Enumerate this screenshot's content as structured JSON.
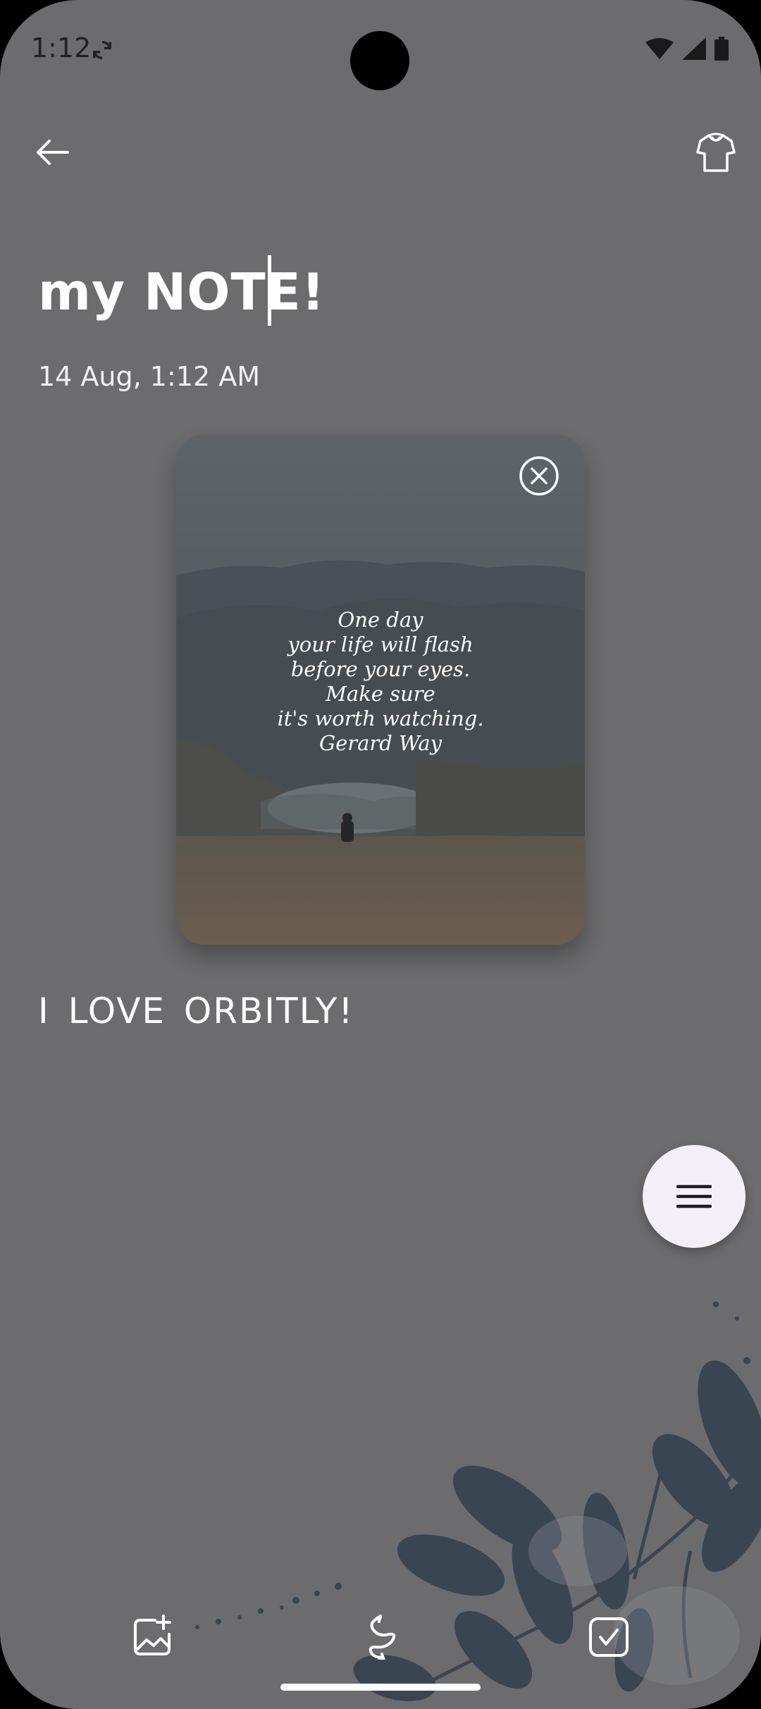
{
  "status_bar": {
    "time": "1:12",
    "icons": [
      "sync-icon",
      "wifi-icon",
      "signal-icon",
      "battery-icon"
    ]
  },
  "toolbar": {
    "back_icon": "arrow-left-icon",
    "theme_icon": "shirt-icon"
  },
  "note": {
    "title": "my NOTE!",
    "date": "14 Aug, 1:12  AM",
    "body": "I  LOVE  ORBITLY!"
  },
  "attached_image": {
    "quote_lines": [
      "One day",
      "your life will flash",
      "before your eyes.",
      "Make sure",
      "it's worth watching.",
      "Gerard Way"
    ],
    "close_icon": "close-circle-icon"
  },
  "fab": {
    "icon": "menu-icon"
  },
  "bottom_bar": {
    "icons": [
      "add-image-icon",
      "draw-icon",
      "checkbox-icon"
    ]
  },
  "colors": {
    "background": "#6c6c6f",
    "text": "#ffffff",
    "fab": "#f3eff7",
    "leaf": "#3a4552"
  }
}
